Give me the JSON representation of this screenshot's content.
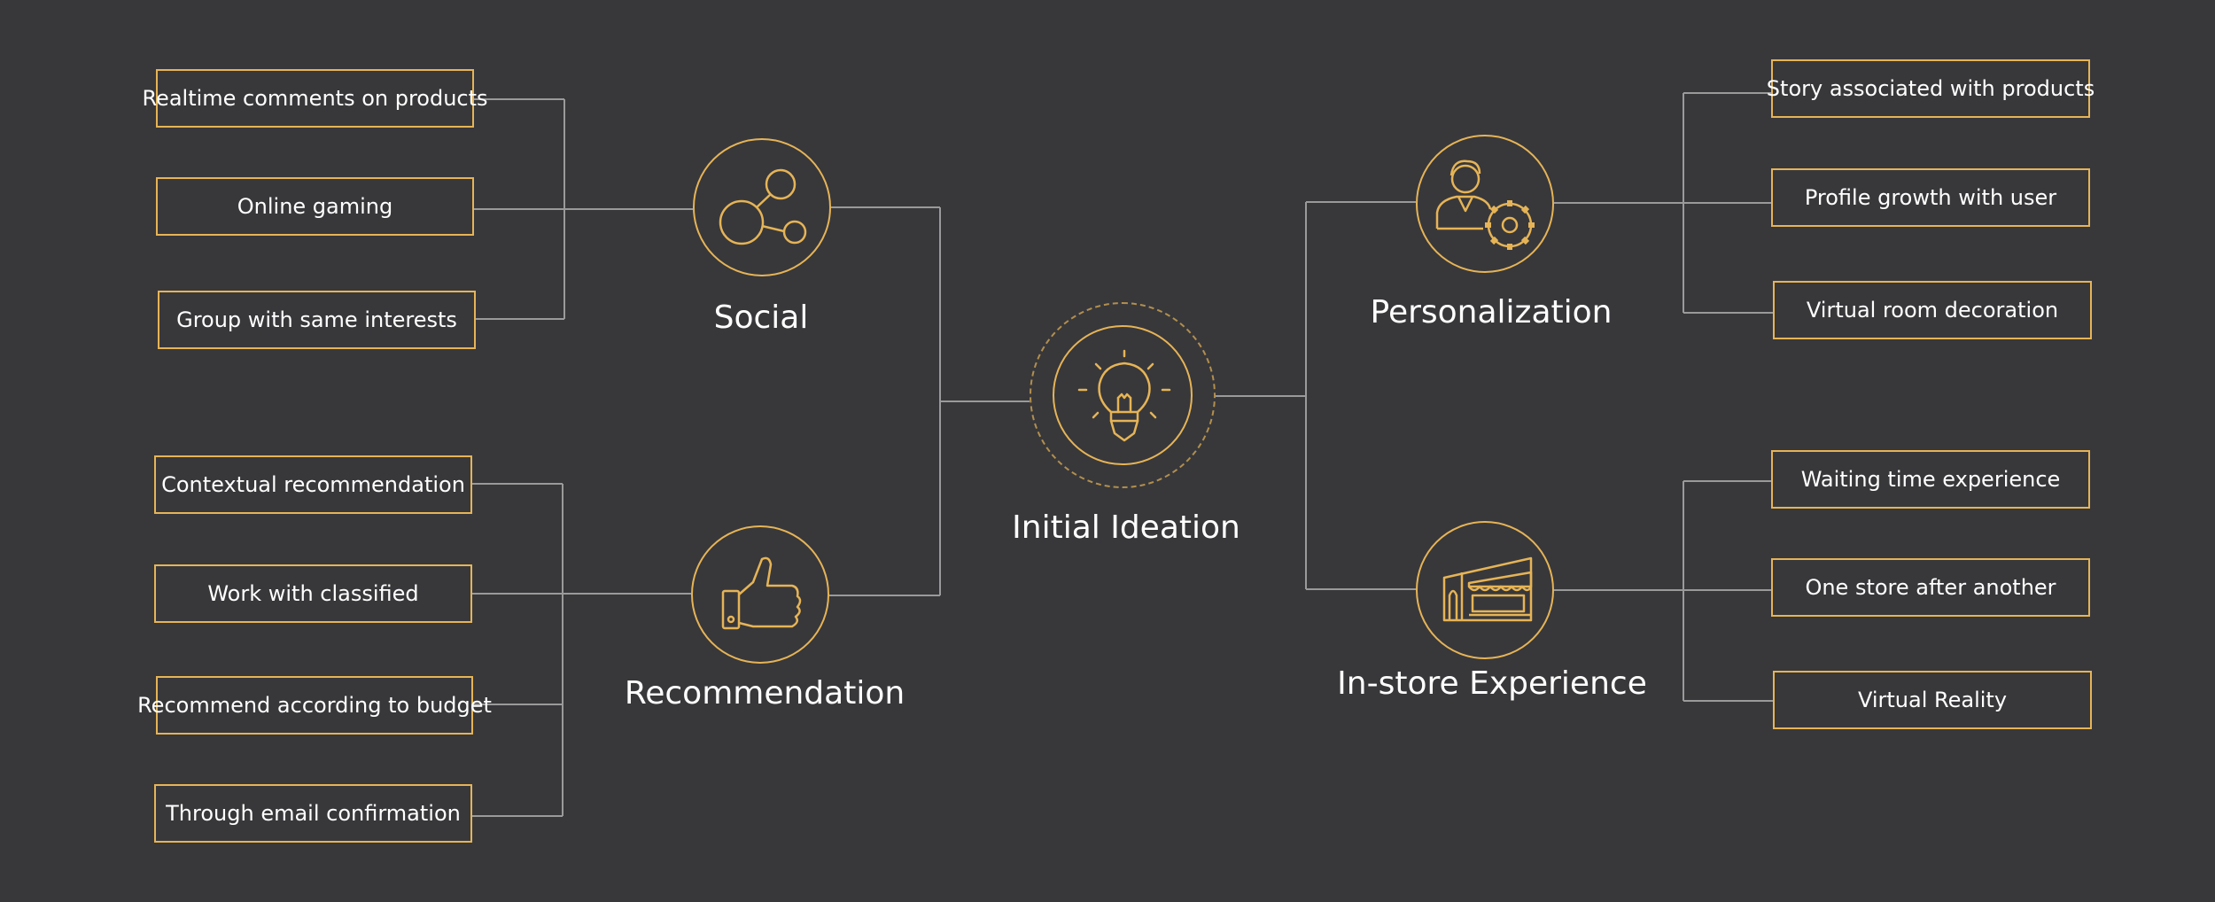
{
  "center": {
    "label": "Initial Ideation"
  },
  "categories": {
    "social": {
      "label": "Social",
      "items": [
        "Realtime comments on products",
        "Online gaming",
        "Group with same interests"
      ]
    },
    "recommendation": {
      "label": "Recommendation",
      "items": [
        "Contextual recommendation",
        "Work with classified",
        "Recommend according to budget",
        "Through email confirmation"
      ]
    },
    "personalization": {
      "label": "Personalization",
      "items": [
        "Story associated with products",
        "Profile growth with user",
        "Virtual room decoration"
      ]
    },
    "instore": {
      "label": "In-store Experience",
      "items": [
        "Waiting time experience",
        "One store after another",
        "Virtual Reality"
      ]
    }
  },
  "colors": {
    "background": "#38383b",
    "accent": "#e6b456",
    "line": "#9a9a9a",
    "text": "#ffffff"
  },
  "icons": {
    "center": "lightbulb-icon",
    "social": "share-network-icon",
    "recommendation": "thumbs-up-icon",
    "personalization": "user-gear-icon",
    "instore": "storefront-icon"
  }
}
